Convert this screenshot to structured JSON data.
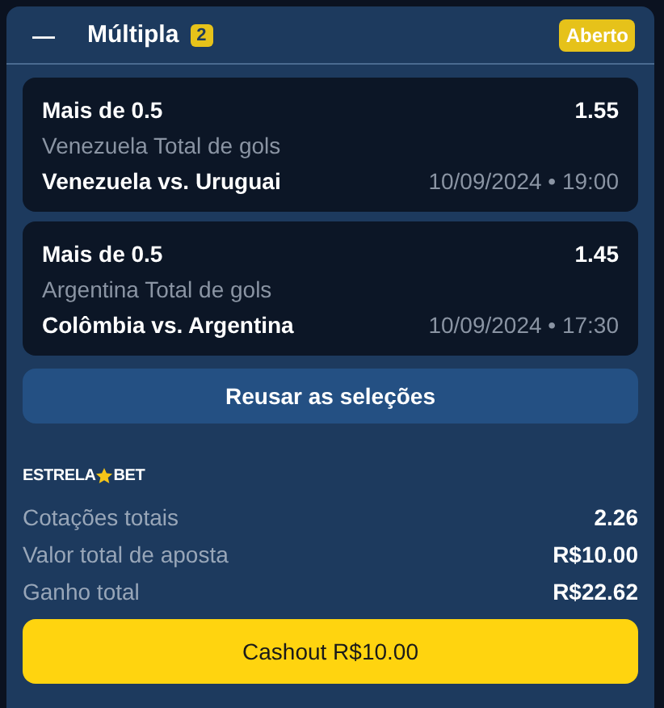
{
  "header": {
    "collapse_icon": "—",
    "title": "Múltipla",
    "count": "2",
    "status": "Aberto"
  },
  "selections": [
    {
      "market": "Mais de 0.5",
      "odds": "1.55",
      "description": "Venezuela Total de gols",
      "match": "Venezuela vs. Uruguai",
      "datetime": "10/09/2024 • 19:00"
    },
    {
      "market": "Mais de 0.5",
      "odds": "1.45",
      "description": "Argentina Total de gols",
      "match": "Colômbia vs. Argentina",
      "datetime": "10/09/2024 • 17:30"
    }
  ],
  "reuse_button": "Reusar as seleções",
  "brand": {
    "left": "ESTRELA",
    "right": "BET"
  },
  "summary": [
    {
      "label": "Cotações totais",
      "value": "2.26"
    },
    {
      "label": "Valor total de aposta",
      "value": "R$10.00"
    },
    {
      "label": "Ganho total",
      "value": "R$22.62"
    }
  ],
  "cashout_button": "Cashout R$10.00"
}
